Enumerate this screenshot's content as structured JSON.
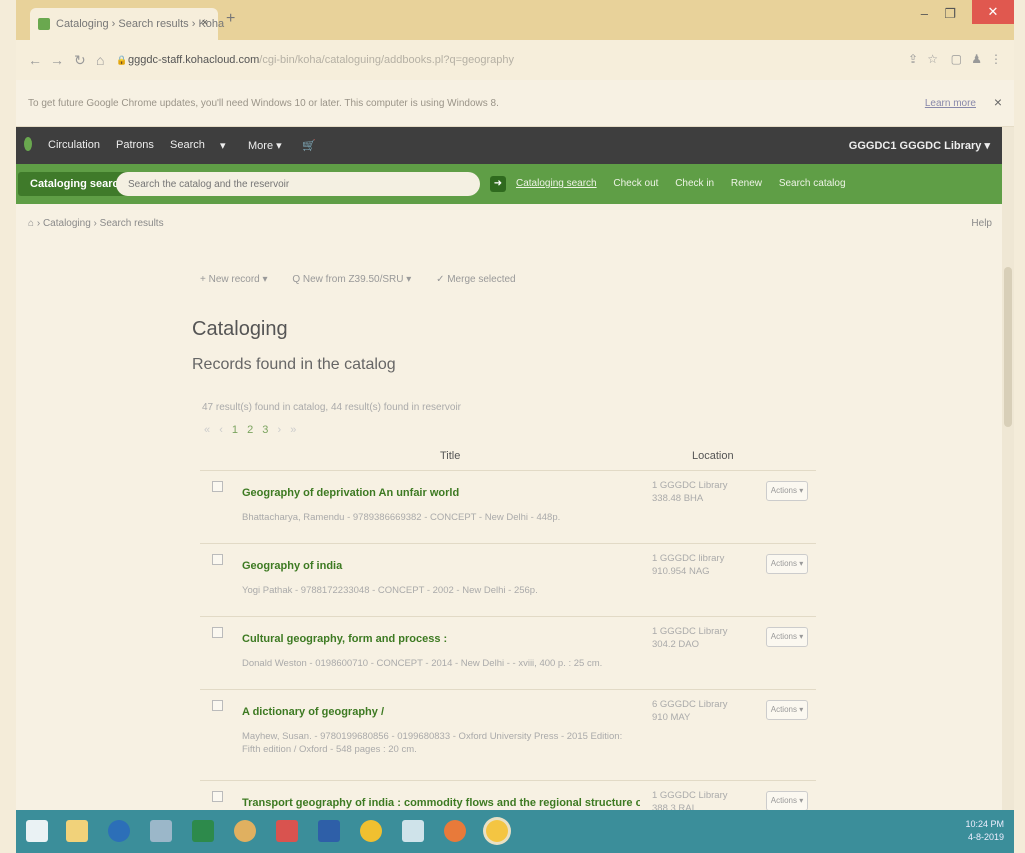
{
  "browser": {
    "tab_title": "Cataloging › Search results › Koha",
    "tab_close": "×",
    "new_tab": "+",
    "url_domain": "gggdc-staff.kohacloud.com",
    "url_path": "/cgi-bin/koha/cataloguing/addbooks.pl?q=geography",
    "info_message": "To get future Google Chrome updates, you'll need Windows 10 or later. This computer is using Windows 8.",
    "learn_more": "Learn more",
    "info_close": "×"
  },
  "menu": {
    "items": [
      "Circulation",
      "Patrons",
      "Search",
      "▾",
      "More ▾"
    ],
    "library": "GGGDC1 GGGDC Library ▾"
  },
  "searchbar": {
    "label": "Cataloging search",
    "placeholder": "Search the catalog and the reservoir",
    "tabs": [
      "Cataloging search",
      "Check out",
      "Check in",
      "Renew",
      "Search catalog"
    ]
  },
  "breadcrumb": {
    "home_icon": "home-icon",
    "sep": "›",
    "items": [
      "Cataloging",
      "Search results"
    ],
    "help": "Help"
  },
  "toolbar": {
    "new_record": "+ New record ▾",
    "new_z3950": "Q New from Z39.50/SRU ▾",
    "merge": "✓ Merge selected"
  },
  "page": {
    "title": "Cataloging",
    "subtitle": "Records found in the catalog",
    "summary": "47 result(s) found in catalog, 44 result(s) found in reservoir",
    "pager": {
      "first": "«",
      "prev": "‹",
      "pages": [
        "1",
        "2",
        "3"
      ],
      "next": "›",
      "last": "»"
    }
  },
  "table": {
    "headers": {
      "title": "Title",
      "location": "Location"
    },
    "rows": [
      {
        "title": "Geography of deprivation An unfair world",
        "meta": "Bhattacharya, Ramendu - 9789386669382 - CONCEPT - New Delhi - 448p.",
        "location": "1 GGGDC Library 338.48 BHA",
        "action": "Actions ▾"
      },
      {
        "title": "Geography of india",
        "meta": "Yogi Pathak - 9788172233048 - CONCEPT - 2002 - New Delhi - 256p.",
        "location": "1 GGGDC library 910.954 NAG",
        "action": "Actions ▾"
      },
      {
        "title": "Cultural geography, form and process :",
        "meta": "Donald Weston - 0198600710 - CONCEPT - 2014 - New Delhi - - xviii, 400 p. : 25 cm.",
        "location": "1 GGGDC Library 304.2 DAO",
        "action": "Actions ▾"
      },
      {
        "title": "A dictionary of geography /",
        "meta": "Mayhew, Susan. - 9780199680856 - 0199680833 - Oxford University Press - 2015 Edition: Fifth edition / Oxford - 548 pages : 20 cm.",
        "location": "6 GGGDC Library 910 MAY",
        "action": "Actions ▾"
      },
      {
        "title": "Transport geography of india : commodity flows and the regional structure of the Indian",
        "meta": "",
        "location": "1 GGGDC Library 388.3 RAI",
        "action": "Actions ▾"
      }
    ]
  },
  "taskbar": {
    "time": "10:24 PM",
    "date": "4-8-2019"
  }
}
